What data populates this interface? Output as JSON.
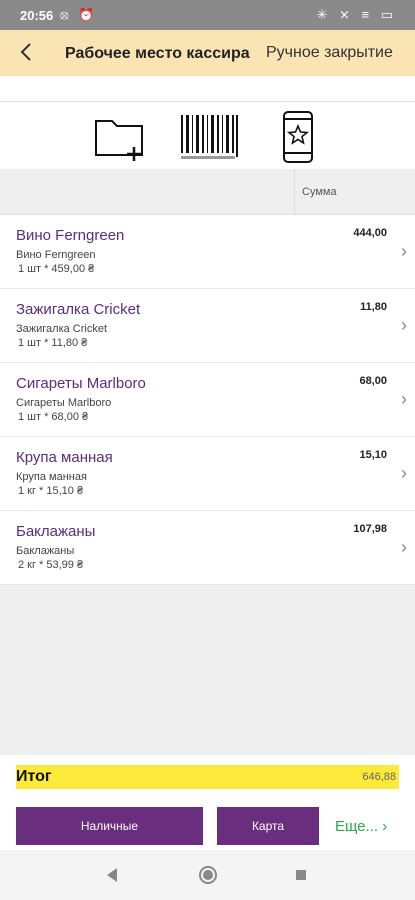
{
  "status_bar": {
    "time": "20:56",
    "left_icons": "⦻ ⏰",
    "right_icons": "✳ ⨯ ≡ ▭"
  },
  "app_bar": {
    "back_icon": "chevron-left-icon",
    "title": "Рабочее место кассира",
    "manual_close": "Ручное закрытие"
  },
  "toolbar": {
    "icons": [
      "folder-add-icon",
      "barcode-icon",
      "phone-star-icon"
    ]
  },
  "table_header": {
    "sum_label": "Сумма"
  },
  "items": [
    {
      "name": "Вино Ferngreen",
      "sub": "Вино Ferngreen",
      "qty": "1 шт * 459,00 ₴",
      "amount": "444,00"
    },
    {
      "name": "Зажигалка Cricket",
      "sub": "Зажигалка Cricket",
      "qty": "1 шт * 11,80 ₴",
      "amount": "11,80"
    },
    {
      "name": "Сигареты Marlboro",
      "sub": "Сигареты Marlboro",
      "qty": "1 шт * 68,00 ₴",
      "amount": "68,00"
    },
    {
      "name": "Крупа манная",
      "sub": "Крупа манная",
      "qty": "1 кг * 15,10 ₴",
      "amount": "15,10"
    },
    {
      "name": "Баклажаны",
      "sub": "Баклажаны",
      "qty": "2 кг * 53,99 ₴",
      "amount": "107,98"
    }
  ],
  "total": {
    "label": "Итог",
    "value": "646,88"
  },
  "buttons": {
    "cash": "Наличные",
    "card": "Карта",
    "more": "Еще... ›"
  },
  "colors": {
    "accent": "#6a2e7e",
    "appbar": "#fbe4b4",
    "total_bar": "#fbea3c",
    "more_link": "#2fa64a"
  }
}
